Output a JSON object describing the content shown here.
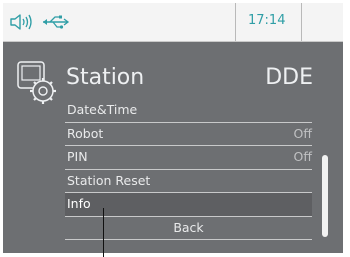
{
  "statusbar": {
    "time": "17:14",
    "icons": [
      "speaker-icon",
      "usb-icon"
    ]
  },
  "header": {
    "title": "Station",
    "subtitle": "DDE",
    "icon": "station-settings-icon"
  },
  "menu": {
    "items": [
      {
        "label": "Date&Time",
        "value": ""
      },
      {
        "label": "Robot",
        "value": "Off"
      },
      {
        "label": "PIN",
        "value": "Off"
      },
      {
        "label": "Station Reset",
        "value": ""
      },
      {
        "label": "Info",
        "value": "",
        "selected": true
      },
      {
        "label": "Back",
        "value": ""
      }
    ]
  },
  "colors": {
    "screen_bg": "#6d6f72",
    "statusbar_bg": "#f4f4f4",
    "accent": "#2f9ea6",
    "text": "#eef0f2"
  }
}
